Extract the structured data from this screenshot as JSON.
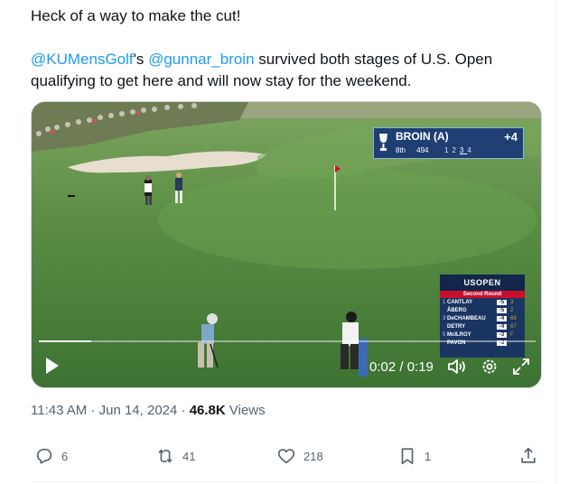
{
  "tweet": {
    "line1": "Heck of a way to make the cut!",
    "mention1": "@KUMensGolf",
    "possessive": "'s ",
    "mention2": "@gunnar_broin",
    "rest_line2": " survived both stages of U.S. Open",
    "line3": "qualifying to get here and will now stay for the weekend."
  },
  "video": {
    "score_top": {
      "name": "BROIN (A)",
      "position": "8th",
      "yards": "494",
      "holes": [
        "1",
        "2",
        "3",
        "4"
      ],
      "current_hole": "3",
      "total": "+4"
    },
    "leaderboard": {
      "brand": "USOPEN",
      "round": "Second Round",
      "rows": [
        {
          "pos": "1",
          "name": "CANTLAY",
          "score": "-5",
          "thru": "3"
        },
        {
          "pos": "",
          "name": "ÅBERG",
          "score": "-5",
          "thru": "2"
        },
        {
          "pos": "3",
          "name": "DeCHAMBEAU",
          "score": "-4",
          "thru": "69"
        },
        {
          "pos": "",
          "name": "DETRY",
          "score": "-4",
          "thru": "67"
        },
        {
          "pos": "5",
          "name": "McILROY",
          "score": "-3",
          "thru": "F"
        },
        {
          "pos": "",
          "name": "PAVON",
          "score": "-3",
          "thru": ""
        }
      ]
    },
    "time_display": "0:02 / 0:19",
    "progress": 0.105
  },
  "meta": {
    "time": "11:43 AM",
    "sep1": " · ",
    "date": "Jun 14, 2024",
    "sep2": " · ",
    "views_count": "46.8K",
    "views_label": " Views"
  },
  "actions": {
    "replies": "6",
    "reposts": "41",
    "likes": "218",
    "bookmarks": "1"
  },
  "colors": {
    "link": "#1d9bf0",
    "muted": "#536471",
    "text": "#0f1419",
    "scoreboard": "#1f3f73"
  },
  "icons": [
    "play-icon",
    "volume-icon",
    "settings-icon",
    "fullscreen-icon",
    "reply-icon",
    "repost-icon",
    "like-icon",
    "bookmark-icon",
    "share-icon"
  ]
}
